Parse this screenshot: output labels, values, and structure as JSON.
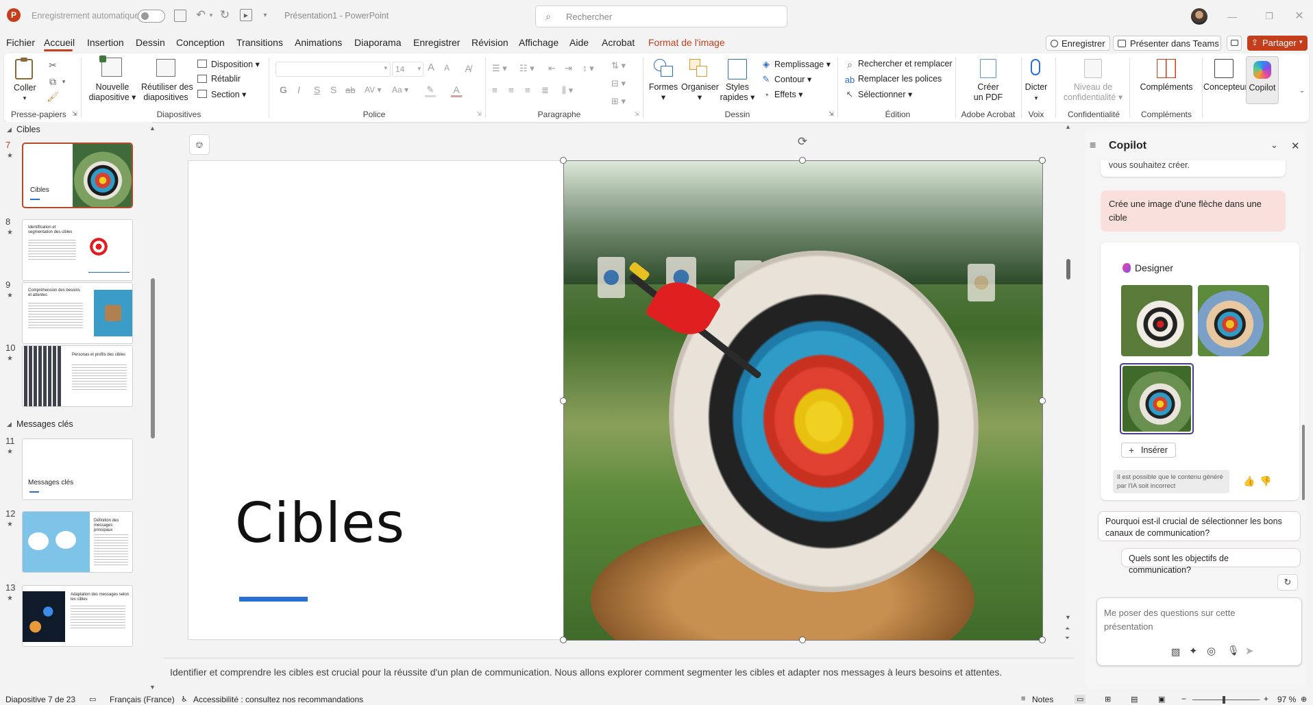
{
  "titlebar": {
    "autosave_label": "Enregistrement automatique",
    "doc_title": "Présentation1",
    "separator": "-",
    "app_name": "PowerPoint",
    "search_placeholder": "Rechercher"
  },
  "menu": {
    "tabs": [
      "Fichier",
      "Accueil",
      "Insertion",
      "Dessin",
      "Conception",
      "Transitions",
      "Animations",
      "Diaporama",
      "Enregistrer",
      "Révision",
      "Affichage",
      "Aide",
      "Acrobat",
      "Format de l'image"
    ],
    "record_button": "Enregistrer",
    "present_teams": "Présenter dans Teams",
    "share": "Partager"
  },
  "ribbon": {
    "clipboard": {
      "paste": "Coller",
      "group": "Presse-papiers"
    },
    "slides": {
      "new_slide_l1": "Nouvelle",
      "new_slide_l2": "diapositive",
      "reuse_l1": "Réutiliser des",
      "reuse_l2": "diapositives",
      "layout": "Disposition",
      "reset": "Rétablir",
      "section": "Section",
      "group": "Diapositives"
    },
    "font": {
      "size": "14",
      "bold": "G",
      "italic": "I",
      "underline": "S",
      "shadow": "S",
      "strike": "ab",
      "spacing": "AV",
      "case": "Aa",
      "grow": "A",
      "shrink": "A",
      "group": "Police"
    },
    "paragraph": {
      "group": "Paragraphe"
    },
    "drawing": {
      "shapes": "Formes",
      "arrange": "Organiser",
      "styles_l1": "Styles",
      "styles_l2": "rapides",
      "fill": "Remplissage",
      "outline": "Contour",
      "effects": "Effets",
      "group": "Dessin"
    },
    "editing": {
      "find_replace": "Rechercher et remplacer",
      "replace_fonts": "Remplacer les polices",
      "select": "Sélectionner",
      "group": "Édition"
    },
    "acrobat": {
      "create_pdf_l1": "Créer",
      "create_pdf_l2": "un PDF",
      "group": "Adobe Acrobat"
    },
    "voice": {
      "dictate": "Dicter",
      "group": "Voix"
    },
    "privacy": {
      "level_l1": "Niveau de",
      "level_l2": "confidentialité",
      "group": "Confidentialité"
    },
    "addins": {
      "addins": "Compléments",
      "group": "Compléments"
    },
    "designer": "Concepteur",
    "copilot": "Copilot"
  },
  "thumbnails": {
    "section_targets": "Cibles",
    "section_messages": "Messages clés",
    "slides": [
      {
        "num": "7",
        "title": "Cibles"
      },
      {
        "num": "8",
        "title": "Identification et segmentation des cibles"
      },
      {
        "num": "9",
        "title": "Compréhension des besoins et attentes"
      },
      {
        "num": "10",
        "title": "Personas et profils des cibles"
      },
      {
        "num": "11",
        "title": "Messages clés"
      },
      {
        "num": "12",
        "title": "Définition des messages principaux"
      },
      {
        "num": "13",
        "title": "Adaptation des messages selon les cibles"
      }
    ]
  },
  "slide": {
    "title": "Cibles"
  },
  "notes": {
    "text": "Identifier et comprendre les cibles est crucial pour la réussite d'un plan de communication. Nous allons explorer comment segmenter les cibles et adapter nos messages à leurs besoins et attentes."
  },
  "copilot": {
    "title": "Copilot",
    "prev_msg_tail": "vous souhaitez créer.",
    "user_msg": "Crée une image d'une flèche dans une cible",
    "designer_label": "Designer",
    "insert_label": "Insérer",
    "disclaimer": "Il est possible que le contenu généré par l'IA soit incorrect",
    "suggestion_1": "Pourquoi est-il crucial de sélectionner les bons canaux de communication?",
    "suggestion_2": "Quels sont les objectifs de communication?",
    "input_placeholder": "Me poser des questions sur cette présentation"
  },
  "status": {
    "slide_of": "Diapositive 7 de 23",
    "language": "Français (France)",
    "accessibility": "Accessibilité : consultez nos recommandations",
    "notes": "Notes",
    "zoom": "97 %"
  },
  "colors": {
    "accent": "#c43e1c",
    "selection": "#b7472a",
    "slide_bar": "#2b6fd3",
    "user_bubble": "#f9e0dc"
  }
}
